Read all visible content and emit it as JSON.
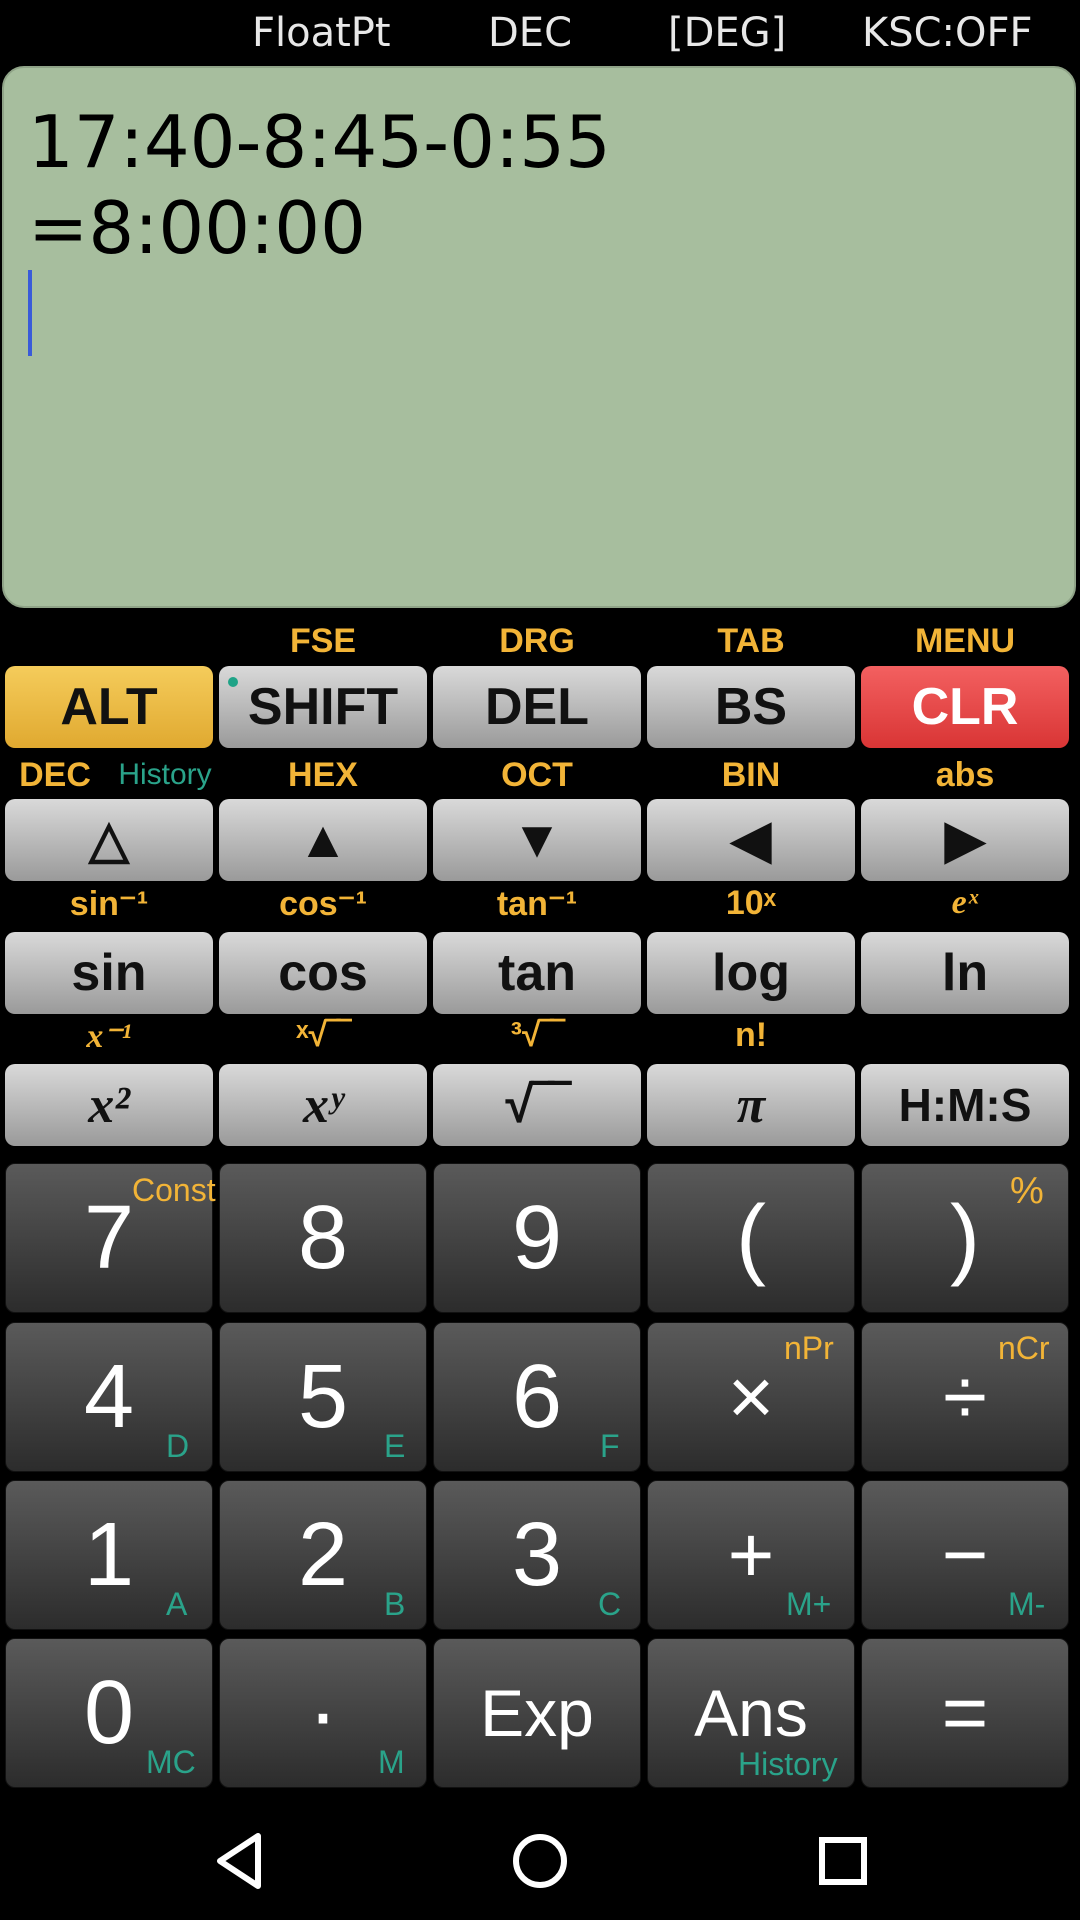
{
  "status": {
    "format": "FloatPt",
    "base": "DEC",
    "angle": "[DEG]",
    "ksc": "KSC:OFF"
  },
  "display": {
    "expression": "17:40-8:45-0:55",
    "result": "=8:00:00"
  },
  "labels_row1": [
    "FSE",
    "DRG",
    "TAB",
    "MENU"
  ],
  "labels_row2": [
    "DEC",
    "History",
    "HEX",
    "OCT",
    "BIN",
    "abs"
  ],
  "labels_row3": [
    "sin⁻¹",
    "cos⁻¹",
    "tan⁻¹",
    "10ˣ",
    "eˣ"
  ],
  "labels_row4": [
    "x⁻¹",
    "ˣ√‾‾",
    "³√‾‾",
    "n!"
  ],
  "row1": [
    "ALT",
    "SHIFT",
    "DEL",
    "BS",
    "CLR"
  ],
  "row2": [
    "△",
    "▲",
    "▼",
    "◀",
    "▶"
  ],
  "row3": [
    "sin",
    "cos",
    "tan",
    "log",
    "ln"
  ],
  "row4": [
    "x²",
    "xʸ",
    "√‾‾",
    "π",
    "H:M:S"
  ],
  "keypad": {
    "r1": [
      "7",
      "8",
      "9",
      "(",
      ")"
    ],
    "r2": [
      "4",
      "5",
      "6",
      "×",
      "÷"
    ],
    "r3": [
      "1",
      "2",
      "3",
      "+",
      "−"
    ],
    "r4": [
      "0",
      "·",
      "Exp",
      "Ans",
      "="
    ]
  },
  "subs": {
    "const": "Const",
    "percent": "%",
    "npr": "nPr",
    "ncr": "nCr",
    "d": "D",
    "e": "E",
    "f": "F",
    "a": "A",
    "b": "B",
    "c": "C",
    "mplus": "M+",
    "mminus": "M-",
    "mc": "MC",
    "m": "M",
    "history": "History"
  }
}
